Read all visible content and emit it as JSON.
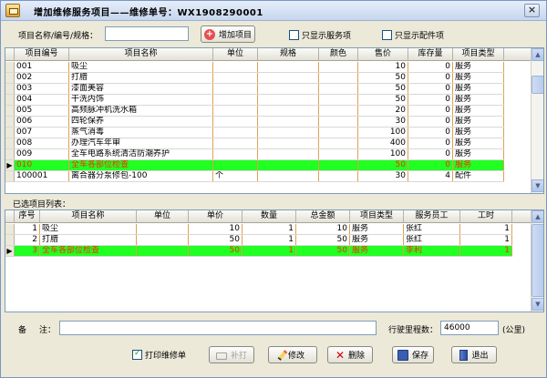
{
  "window": {
    "title": "增加维修服务项目——维修单号：WX1908290001"
  },
  "search": {
    "label": "项目名称/编号/规格：",
    "value": "",
    "add_button": "增加项目",
    "only_service": "只显示服务项",
    "only_parts": "只显示配件项"
  },
  "items_table": {
    "columns": [
      "项目编号",
      "项目名称",
      "单位",
      "规格",
      "颜色",
      "售价",
      "库存量",
      "项目类型"
    ],
    "rows": [
      [
        "001",
        "吸尘",
        "",
        "",
        "",
        "10",
        "0",
        "服务"
      ],
      [
        "002",
        "打腊",
        "",
        "",
        "",
        "50",
        "0",
        "服务"
      ],
      [
        "003",
        "漆面美容",
        "",
        "",
        "",
        "50",
        "0",
        "服务"
      ],
      [
        "004",
        "干洗内饰",
        "",
        "",
        "",
        "50",
        "0",
        "服务"
      ],
      [
        "005",
        "高频脉冲机洗水箱",
        "",
        "",
        "",
        "20",
        "0",
        "服务"
      ],
      [
        "006",
        "四轮保养",
        "",
        "",
        "",
        "30",
        "0",
        "服务"
      ],
      [
        "007",
        "蒸气消毒",
        "",
        "",
        "",
        "100",
        "0",
        "服务"
      ],
      [
        "008",
        "办理汽车年审",
        "",
        "",
        "",
        "400",
        "0",
        "服务"
      ],
      [
        "009",
        "全车电路系统清洁防潮养护",
        "",
        "",
        "",
        "100",
        "0",
        "服务"
      ],
      [
        "010",
        "全车各部位检查",
        "",
        "",
        "",
        "50",
        "0",
        "服务"
      ],
      [
        "100001",
        "离合器分泵修包-100",
        "个",
        "",
        "",
        "30",
        "4",
        "配件"
      ]
    ],
    "selected_index": 9
  },
  "selected_label": "已选项目列表：",
  "selected_table": {
    "columns": [
      "序号",
      "项目名称",
      "单位",
      "单价",
      "数量",
      "总金额",
      "项目类型",
      "服务员工",
      "工时"
    ],
    "rows": [
      [
        "1",
        "吸尘",
        "",
        "10",
        "1",
        "10",
        "服务",
        "张红",
        "1"
      ],
      [
        "2",
        "打腊",
        "",
        "50",
        "1",
        "50",
        "服务",
        "张红",
        "1"
      ],
      [
        "3",
        "全车各部位检查",
        "",
        "50",
        "1",
        "50",
        "服务",
        "李利",
        "1"
      ]
    ],
    "selected_index": 2
  },
  "remark": {
    "label_a": "备",
    "label_b": "注：",
    "value": ""
  },
  "mileage": {
    "label": "行驶里程数：",
    "value": "46000",
    "unit": "(公里)"
  },
  "footer": {
    "print_label": "打印维修单",
    "print_checked": true,
    "reprint": "补打",
    "edit": "修改",
    "delete": "删除",
    "save": "保存",
    "exit": "退出"
  }
}
